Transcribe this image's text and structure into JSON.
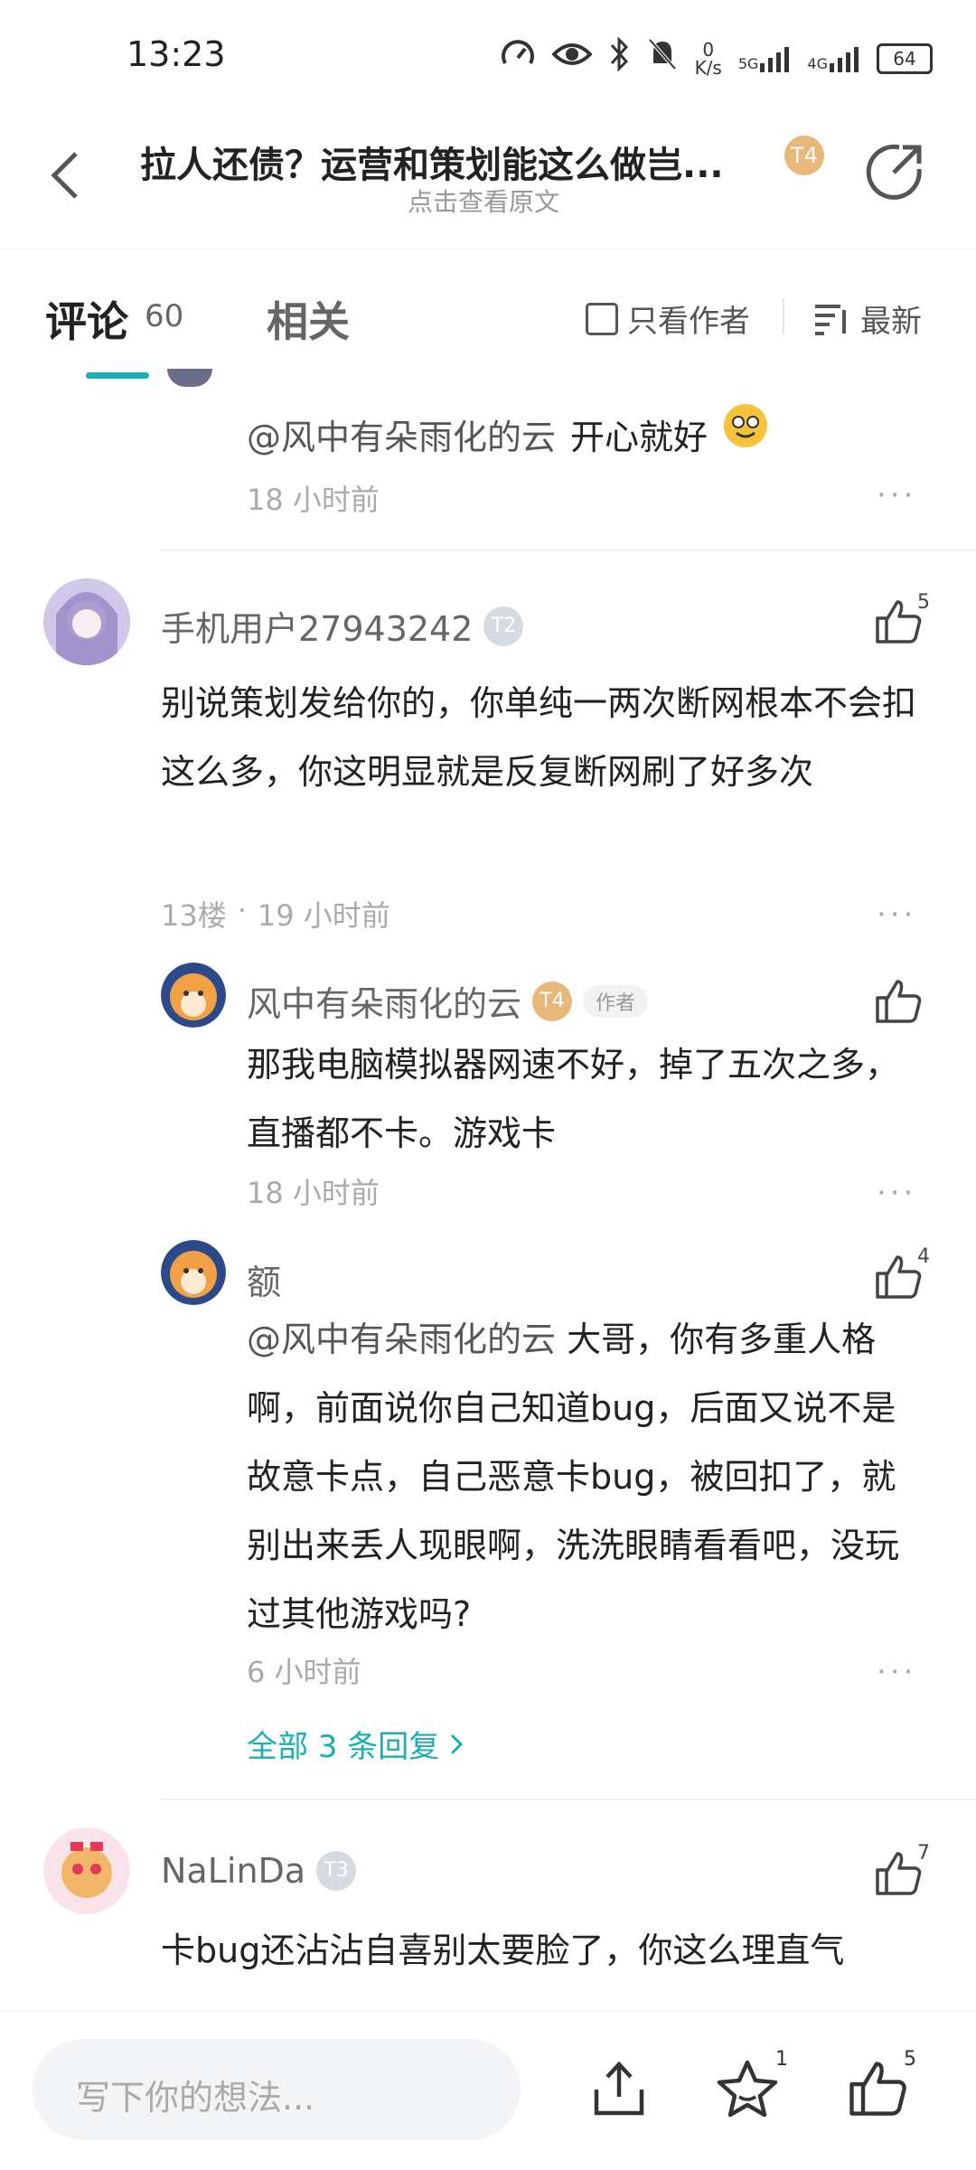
{
  "status_bar": {
    "time": "13:23",
    "net_speed_value": "0",
    "net_speed_unit": "K/s",
    "signal_1": "5G",
    "signal_2": "4G",
    "battery": "64"
  },
  "header": {
    "title": "拉人还债？运营和策划能这么做岂...",
    "subtitle": "点击查看原文",
    "level_badge": "T4"
  },
  "tabs": {
    "comment_label": "评论",
    "comment_count": "60",
    "related_label": "相关",
    "author_only_label": "只看作者",
    "sort_label": "最新"
  },
  "comments": {
    "top_partial": {
      "mention": "@风中有朵雨化的云",
      "text": "开心就好",
      "time": "18 小时前"
    },
    "c13": {
      "username": "手机用户27943242",
      "level": "T2",
      "likes": "5",
      "text": "别说策划发给你的，你单纯一两次断网根本不会扣这么多，你这明显就是反复断网刷了好多次",
      "floor": "13楼",
      "time": "19 小时前",
      "replies": [
        {
          "username": "风中有朵雨化的云",
          "level": "T4",
          "tag": "作者",
          "likes": "",
          "text": "那我电脑模拟器网速不好，掉了五次之多，直播都不卡。游戏卡",
          "time": "18 小时前"
        },
        {
          "username": "额",
          "likes": "4",
          "mention": "@风中有朵雨化的云",
          "text": "大哥，你有多重人格啊，前面说你自己知道bug，后面又说不是故意卡点，自己恶意卡bug，被回扣了，就别出来丢人现眼啊，洗洗眼睛看看吧，没玩过其他游戏吗?",
          "time": "6 小时前"
        }
      ],
      "all_replies_label": "全部 3 条回复"
    },
    "c12": {
      "username": "NaLinDa",
      "level": "T3",
      "likes": "7",
      "text": "卡bug还沾沾自喜别太要脸了，你这么理直气"
    }
  },
  "bottom_bar": {
    "input_placeholder": "写下你的想法...",
    "star_count": "1",
    "like_count": "5"
  },
  "colors": {
    "accent": "#1aaeb5",
    "gold_badge": "#e7b879",
    "grey_badge": "#d5dbe0"
  }
}
